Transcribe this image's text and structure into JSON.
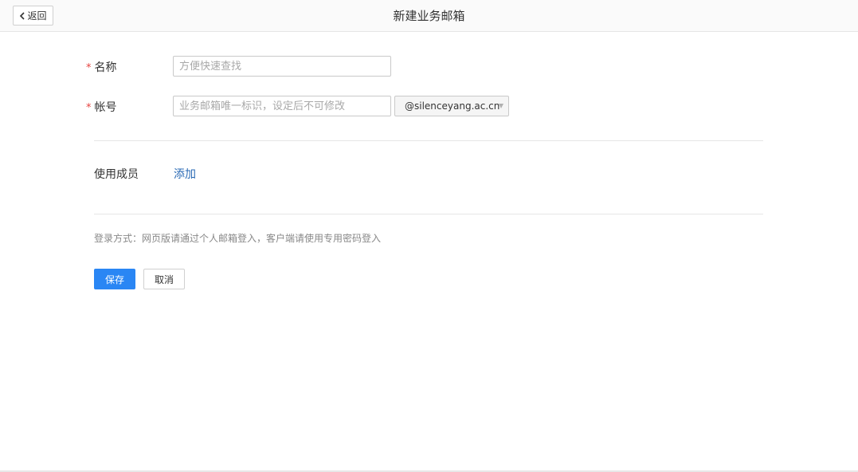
{
  "header": {
    "back_label": "返回",
    "title": "新建业务邮箱"
  },
  "form": {
    "required_mark": "*",
    "name": {
      "label": "名称",
      "placeholder": "方便快速查找",
      "value": ""
    },
    "account": {
      "label": "帐号",
      "placeholder": "业务邮箱唯一标识，设定后不可修改",
      "value": "",
      "domain_selected": "@silenceyang.ac.cn"
    },
    "members": {
      "label": "使用成员",
      "add_label": "添加"
    },
    "login_hint": "登录方式：网页版请通过个人邮箱登入，客户端请使用专用密码登入"
  },
  "actions": {
    "save_label": "保存",
    "cancel_label": "取消"
  },
  "colors": {
    "primary": "#2a86f4",
    "link": "#2a6ab4",
    "required": "#e64340"
  },
  "icons": {
    "back": "chevron-left-icon",
    "dropdown": "caret-down-icon"
  }
}
